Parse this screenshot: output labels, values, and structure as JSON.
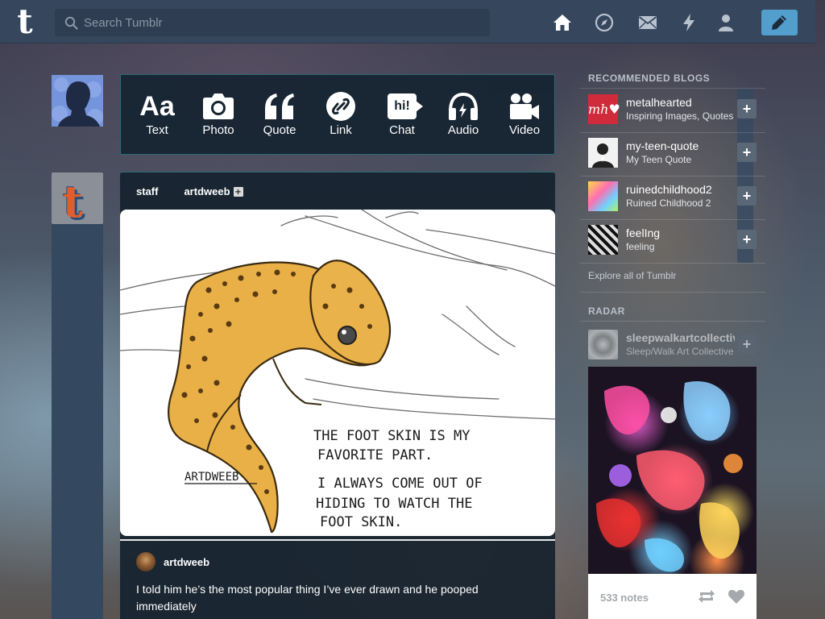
{
  "header": {
    "logo": "t",
    "search_placeholder": "Search Tumblr",
    "nav": [
      "home-icon",
      "explore-icon",
      "inbox-icon",
      "activity-icon",
      "account-icon"
    ],
    "compose_icon": "pencil-icon",
    "accent": "#529ecc",
    "bar_color": "#36465d"
  },
  "post_types": [
    {
      "label": "Text",
      "icon": "Aa"
    },
    {
      "label": "Photo",
      "icon": "camera-icon"
    },
    {
      "label": "Quote",
      "icon": "quote-icon"
    },
    {
      "label": "Link",
      "icon": "link-icon"
    },
    {
      "label": "Chat",
      "icon": "hi!"
    },
    {
      "label": "Audio",
      "icon": "headphones-icon"
    },
    {
      "label": "Video",
      "icon": "video-camera-icon"
    }
  ],
  "post": {
    "reblogger": "staff",
    "source": "artdweeb",
    "image_text": {
      "signature": "ARTDWEEB",
      "line1": "THE FOOT SKIN IS MY",
      "line2": "FAVORITE PART.",
      "line3": "I ALWAYS COME OUT OF",
      "line4": "HIDING TO WATCH THE",
      "line5": "FOOT SKIN."
    },
    "caption_author": "artdweeb",
    "caption": "I told him he’s the most popular thing I’ve ever drawn and he pooped immediately"
  },
  "sidebar": {
    "recommended_heading": "RECOMMENDED BLOGS",
    "blogs": [
      {
        "name": "metalhearted",
        "desc": "Inspiring Images, Quotes",
        "avatar_text": "mh♥"
      },
      {
        "name": "my-teen-quote",
        "desc": "My Teen Quote"
      },
      {
        "name": "ruinedchildhood2",
        "desc": "Ruined Childhood 2"
      },
      {
        "name": "feelIng",
        "desc": "feeling"
      }
    ],
    "follow_label": "+",
    "explore_link": "Explore all of Tumblr",
    "radar_heading": "RADAR",
    "radar_blog": {
      "name": "sleepwalkartcollective",
      "desc": "Sleep/Walk Art Collective"
    },
    "radar_notes": "533 notes"
  }
}
